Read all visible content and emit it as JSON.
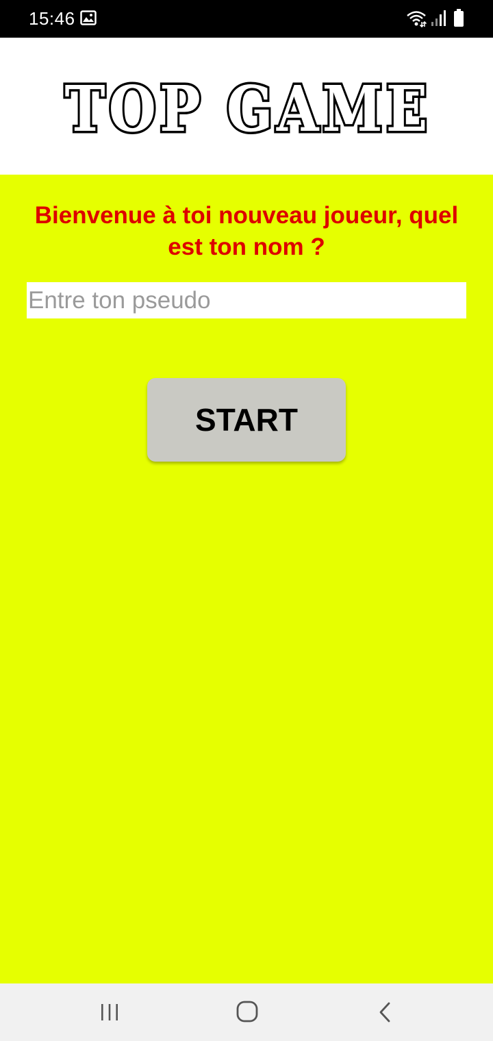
{
  "status_bar": {
    "time": "15:46",
    "icons": [
      "gallery-icon",
      "wifi-icon",
      "signal-icon",
      "battery-icon"
    ]
  },
  "header": {
    "logo_text": "TOP GAME"
  },
  "main": {
    "background_color": "#e6ff00",
    "welcome_text": "Bienvenue à toi nouveau joueur, quel est ton nom ?",
    "pseudo_input": {
      "value": "",
      "placeholder": "Entre ton pseudo"
    },
    "start_button_label": "START"
  },
  "colors": {
    "accent_text": "#dd0000",
    "button_bg": "#c9c9c3",
    "header_bg": "#ffffff"
  },
  "nav_bar": {
    "icons": [
      "recent-apps-icon",
      "home-icon",
      "back-icon"
    ]
  }
}
